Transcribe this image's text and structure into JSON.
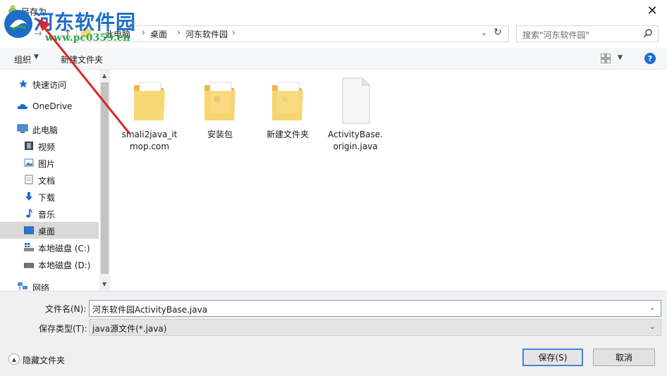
{
  "window": {
    "title": "另存为",
    "close_glyph": "✕"
  },
  "watermark": {
    "title": "河东软件园",
    "url": "www.pc0359.cn"
  },
  "address_bar": {
    "back_glyph": "←",
    "forward_glyph": "→",
    "up_glyph": "↑",
    "breadcrumbs": [
      "此电脑",
      "桌面",
      "河东软件园"
    ],
    "separator": "›",
    "dropdown_glyph": "⌄",
    "refresh_glyph": "↻"
  },
  "search": {
    "placeholder": "搜索\"河东软件园\""
  },
  "toolbar": {
    "organize_label": "组织",
    "organize_arrow": "▼",
    "new_folder_label": "新建文件夹",
    "view_arrow": "▼",
    "help_glyph": "?"
  },
  "nav": {
    "items": [
      {
        "label": "快速访问",
        "icon": "star-icon"
      },
      {
        "label": "OneDrive",
        "icon": "cloud-icon"
      },
      {
        "label": "此电脑",
        "icon": "computer-icon"
      },
      {
        "label": "视频",
        "icon": "video-icon"
      },
      {
        "label": "图片",
        "icon": "picture-icon"
      },
      {
        "label": "文档",
        "icon": "document-icon"
      },
      {
        "label": "下载",
        "icon": "download-icon"
      },
      {
        "label": "音乐",
        "icon": "music-icon"
      },
      {
        "label": "桌面",
        "icon": "desktop-icon",
        "selected": true
      },
      {
        "label": "本地磁盘 (C:)",
        "icon": "drive-c-icon"
      },
      {
        "label": "本地磁盘 (D:)",
        "icon": "drive-d-icon"
      },
      {
        "label": "网络",
        "icon": "network-icon"
      }
    ],
    "scroll_up_glyph": "▲",
    "scroll_down_glyph": "▼"
  },
  "files": {
    "items": [
      {
        "label": "smali2java_itmop.com",
        "type": "folder"
      },
      {
        "label": "安装包",
        "type": "folder"
      },
      {
        "label": "新建文件夹",
        "type": "folder"
      },
      {
        "label": "ActivityBase.origin.java",
        "type": "file"
      }
    ]
  },
  "form": {
    "filename_label": "文件名(N):",
    "filename_value": "河东软件园ActivityBase.java",
    "filetype_label": "保存类型(T):",
    "filetype_value": "java源文件(*.java)",
    "dropdown_glyph": "⌄",
    "hide_folders_label": "隐藏文件夹",
    "hide_glyph": "▲",
    "save_label": "保存(S)",
    "cancel_label": "取消"
  },
  "colors": {
    "accent": "#1c6cd1",
    "watermark_blue": "#1e6ec8",
    "watermark_green": "#2ba84a",
    "folder": "#f3d47a",
    "arrow_red": "#d8282a"
  }
}
